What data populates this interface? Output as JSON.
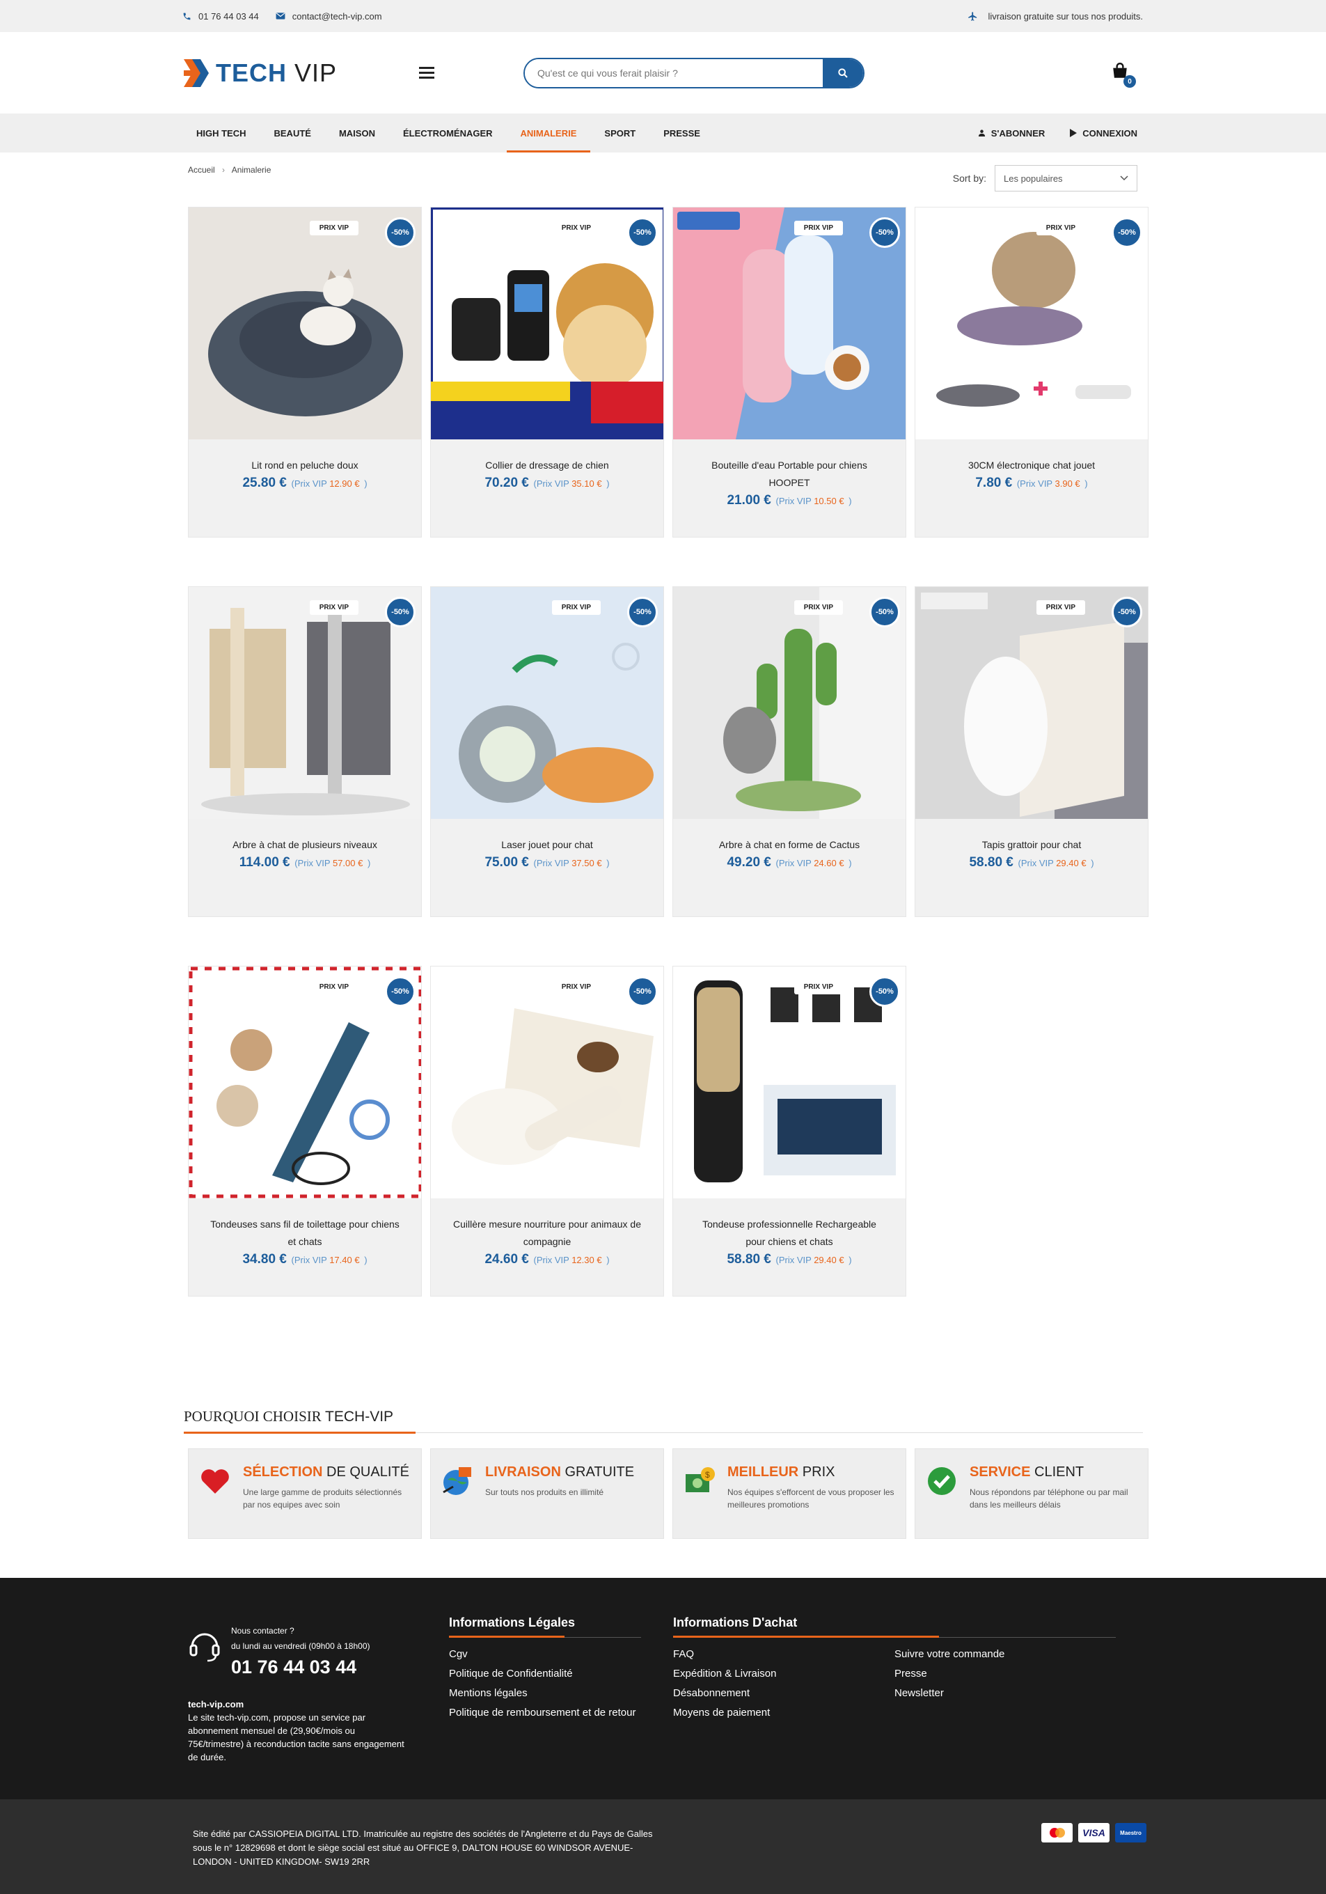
{
  "topbar": {
    "phone": "01 76 44 03 44",
    "email": "contact@tech-vip.com",
    "shipping": "livraison gratuite sur tous nos produits."
  },
  "header": {
    "logo_part1": "TECH",
    "logo_part2": "VIP",
    "search_placeholder": "Qu'est ce qui vous ferait plaisir ?",
    "cart_count": "0"
  },
  "nav": {
    "items": [
      "HIGH TECH",
      "BEAUTÉ",
      "MAISON",
      "ÉLECTROMÉNAGER",
      "ANIMALERIE",
      "SPORT",
      "PRESSE"
    ],
    "active": "ANIMALERIE",
    "subscribe": "S'ABONNER",
    "login": "CONNEXION"
  },
  "breadcrumb": {
    "home": "Accueil",
    "current": "Animalerie"
  },
  "sort": {
    "label": "Sort by:",
    "value": "Les populaires"
  },
  "badges": {
    "vip": "PRIX VIP",
    "discount": "-50%"
  },
  "price_labels": {
    "vip_label": "(Prix VIP",
    "close": ")"
  },
  "products": [
    {
      "name": "Lit rond en peluche doux",
      "price": "25.80 €",
      "vip": "12.90 €",
      "colors": {
        "bg": "#e8e4df",
        "main": "#4a5563"
      }
    },
    {
      "name": "Collier de dressage de chien",
      "price": "70.20 €",
      "vip": "35.10 €",
      "colors": {
        "bg": "#ffffff",
        "main": "#d69a45"
      }
    },
    {
      "name": "Bouteille d'eau Portable pour chiens HOOPET",
      "price": "21.00 €",
      "vip": "10.50 €",
      "colors": {
        "bg": "#7aa6dc",
        "main": "#f3b9c6"
      }
    },
    {
      "name": "30CM électronique chat jouet",
      "price": "7.80 €",
      "vip": "3.90 €",
      "colors": {
        "bg": "#ffffff",
        "main": "#8b7a9c"
      }
    },
    {
      "name": "Arbre à chat de plusieurs niveaux",
      "price": "114.00 €",
      "vip": "57.00 €",
      "colors": {
        "bg": "#f2f2f2",
        "main": "#d9c7a6"
      }
    },
    {
      "name": "Laser jouet pour chat",
      "price": "75.00 €",
      "vip": "37.50 €",
      "colors": {
        "bg": "#dde8f4",
        "main": "#e89a4a"
      }
    },
    {
      "name": "Arbre à chat en forme de Cactus",
      "price": "49.20 €",
      "vip": "24.60 €",
      "colors": {
        "bg": "#e9e9e9",
        "main": "#5f9e45"
      }
    },
    {
      "name": "Tapis grattoir pour chat",
      "price": "58.80 €",
      "vip": "29.40 €",
      "colors": {
        "bg": "#d9d9d9",
        "main": "#f1ece4"
      }
    },
    {
      "name": "Tondeuses sans fil de toilettage pour chiens et chats",
      "price": "34.80 €",
      "vip": "17.40 €",
      "colors": {
        "bg": "#ffffff",
        "main": "#2f5a78"
      }
    },
    {
      "name": "Cuillère mesure nourriture pour animaux de compagnie",
      "price": "24.60 €",
      "vip": "12.30 €",
      "colors": {
        "bg": "#ffffff",
        "main": "#f2ece0"
      }
    },
    {
      "name": "Tondeuse professionnelle Rechargeable pour chiens et chats",
      "price": "58.80 €",
      "vip": "29.40 €",
      "colors": {
        "bg": "#ffffff",
        "main": "#c9b184"
      }
    }
  ],
  "why": {
    "title_bold": "POURQUOI CHOISIR",
    "title_light": "TECH-VIP",
    "items": [
      {
        "accent": "SÉLECTION",
        "rest": "DE QUALITÉ",
        "text": "Une large gamme de produits sélectionnés par nos equipes avec soin",
        "icon": "heart-icon"
      },
      {
        "accent": "LIVRAISON",
        "rest": "GRATUITE",
        "text": "Sur touts nos produits en illimité",
        "icon": "globe-icon"
      },
      {
        "accent": "MEILLEUR",
        "rest": "PRIX",
        "text": "Nos équipes s'efforcent de vous proposer les meilleures promotions",
        "icon": "money-icon"
      },
      {
        "accent": "SERVICE",
        "rest": "CLIENT",
        "text": "Nous répondons par téléphone ou par mail dans les meilleurs délais",
        "icon": "check-icon"
      }
    ]
  },
  "footer": {
    "contact_label": "Nous contacter ?",
    "hours": "du lundi au vendredi (09h00 à 18h00)",
    "phone": "01 76 44 03 44",
    "site": "tech-vip.com",
    "about": "Le site tech-vip.com, propose un service par abonnement mensuel de (29,90€/mois ou 75€/trimestre) à reconduction tacite sans engagement de durée.",
    "legal_title": "Informations Légales",
    "legal_links": [
      "Cgv",
      "Politique de Confidentialité",
      "Mentions légales",
      "Politique de remboursement et de retour"
    ],
    "purchase_title": "Informations D'achat",
    "purchase_links_1": [
      "FAQ",
      "Expédition & Livraison",
      "Désabonnement",
      "Moyens de paiement"
    ],
    "purchase_links_2": [
      "Suivre votre commande",
      "Presse",
      "Newsletter"
    ]
  },
  "bottom": {
    "text": "Site édité par CASSIOPEIA DIGITAL LTD. Imatriculée au registre des sociétés de l'Angleterre et du Pays de Galles sous le n° 12829698 et dont le siège social est situé au OFFICE 9, DALTON HOUSE 60 WINDSOR AVENUE- LONDON - UNITED KINGDOM- SW19 2RR",
    "payments": [
      "",
      "VISA",
      "Maestro"
    ]
  }
}
